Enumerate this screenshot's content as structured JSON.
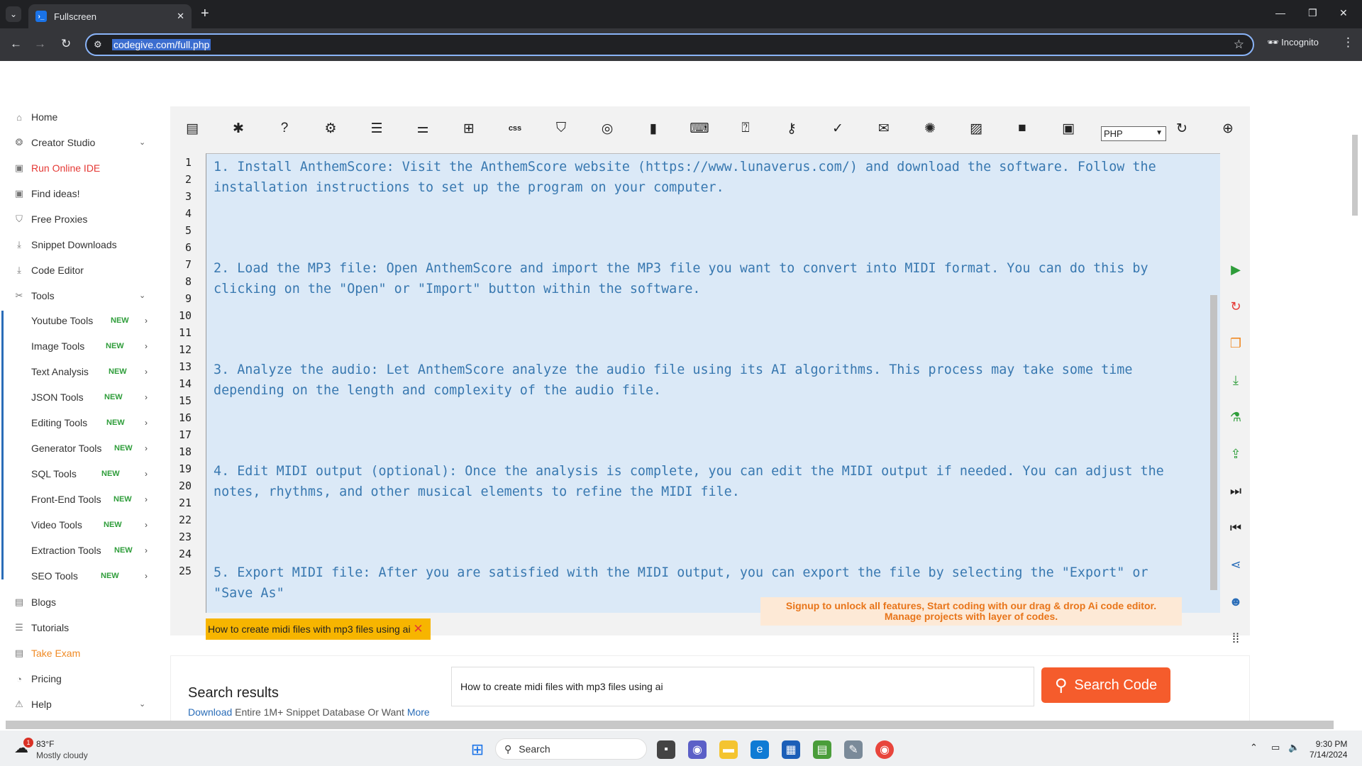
{
  "browser": {
    "tab_title": "Fullscreen",
    "url": "codegive.com/full.php",
    "incognito_label": "Incognito"
  },
  "sidebar": {
    "items": [
      {
        "label": "Home",
        "icon": "home-icon"
      },
      {
        "label": "Creator Studio",
        "icon": "creator-icon"
      },
      {
        "label": "Run Online IDE",
        "icon": "ide-icon"
      },
      {
        "label": "Find ideas!",
        "icon": "ideas-icon"
      },
      {
        "label": "Free Proxies",
        "icon": "shield-icon"
      },
      {
        "label": "Snippet Downloads",
        "icon": "download-icon"
      },
      {
        "label": "Code Editor",
        "icon": "download-icon"
      },
      {
        "label": "Tools",
        "icon": "tools-icon"
      }
    ],
    "tools": [
      {
        "label": "Youtube Tools",
        "badge": "NEW"
      },
      {
        "label": "Image Tools",
        "badge": "NEW"
      },
      {
        "label": "Text Analysis",
        "badge": "NEW"
      },
      {
        "label": "JSON Tools",
        "badge": "NEW"
      },
      {
        "label": "Editing Tools",
        "badge": "NEW"
      },
      {
        "label": "Generator Tools",
        "badge": "NEW"
      },
      {
        "label": "SQL Tools",
        "badge": "NEW"
      },
      {
        "label": "Front-End Tools",
        "badge": "NEW"
      },
      {
        "label": "Video Tools",
        "badge": "NEW"
      },
      {
        "label": "Extraction Tools",
        "badge": "NEW"
      },
      {
        "label": "SEO Tools",
        "badge": "NEW"
      }
    ],
    "bottom": [
      {
        "label": "Blogs",
        "icon": "blog-icon"
      },
      {
        "label": "Tutorials",
        "icon": "list-icon"
      },
      {
        "label": "Take Exam",
        "icon": "exam-icon"
      },
      {
        "label": "Pricing",
        "icon": "pricing-icon"
      },
      {
        "label": "Help",
        "icon": "help-icon"
      }
    ]
  },
  "editor": {
    "language": "PHP",
    "line_numbers": [
      "1",
      "2",
      "3",
      "4",
      "5",
      "6",
      "7",
      "8",
      "9",
      "10",
      "11",
      "12",
      "13",
      "14",
      "15",
      "16",
      "17",
      "18",
      "19",
      "20",
      "21",
      "22",
      "23",
      "24",
      "25"
    ],
    "lines": [
      "1. Install AnthemScore: Visit the AnthemScore website (https://www.lunaverus.com/) and download the software. Follow the",
      "installation instructions to set up the program on your computer.",
      "2. Load the MP3 file: Open AnthemScore and import the MP3 file you want to convert into MIDI format. You can do this by",
      "clicking on the \"Open\" or \"Import\" button within the software.",
      "3. Analyze the audio: Let AnthemScore analyze the audio file using its AI algorithms. This process may take some time",
      "depending on the length and complexity of the audio file.",
      "4. Edit MIDI output (optional): Once the analysis is complete, you can edit the MIDI output if needed. You can adjust the",
      "notes, rhythms, and other musical elements to refine the MIDI file.",
      "5. Export MIDI file: After you are satisfied with the MIDI output, you can export the file by selecting the \"Export\" or",
      "\"Save As\""
    ],
    "tag": "How to create midi files with mp3 files using ai",
    "signup_line1": "Signup to unlock all features, Start coding with our drag & drop Ai code editor.",
    "signup_line2": "Manage projects with layer of codes."
  },
  "results": {
    "title": "Search results",
    "link_prefix": "Download",
    "link_text": " Entire 1M+ Snippet Database Or Want ",
    "link_more": "More",
    "query": "How to create midi files with mp3 files using ai",
    "button": "Search Code"
  },
  "taskbar": {
    "temp": "83°F",
    "weather": "Mostly cloudy",
    "badge": "1",
    "search": "Search",
    "time": "9:30 PM",
    "date": "7/14/2024"
  },
  "colors": {
    "accent_orange": "#f55c2c",
    "code_text": "#3878b0",
    "code_bg": "#dbe9f7",
    "tag_bg": "#f7b500"
  }
}
